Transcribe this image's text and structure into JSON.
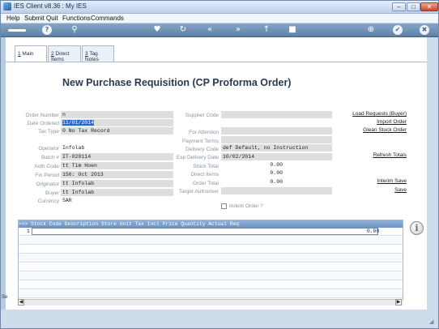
{
  "window": {
    "title": "IES Client v8.36 : My IES",
    "min": "–",
    "max": "□",
    "close": "✕"
  },
  "menu": [
    "Help",
    "Submit",
    "Quit",
    "Functions",
    "Commands"
  ],
  "toolbar": {
    "help": "?",
    "search": "⚲",
    "fav": "♥",
    "refresh": "↻",
    "back": "«",
    "forward": "»",
    "info": "↑",
    "stop": "■",
    "globe": "⊕",
    "ok": "✔",
    "close": "✖"
  },
  "tabs": [
    {
      "prefix": "1",
      "label": " Main"
    },
    {
      "prefix": "2",
      "label": " Direct Items"
    },
    {
      "prefix": "3",
      "label": " Tag Notes"
    }
  ],
  "page_title": "New Purchase  Requisition  (CP Proforma Order)",
  "left_fields": [
    {
      "label": "Order Number",
      "value": "n"
    },
    {
      "label": "Date Ordered",
      "value": "11/01/2014"
    },
    {
      "label": "Tax Type",
      "value": "0 No Tax Record"
    },
    {
      "label": "Operator",
      "value": "Infolab"
    },
    {
      "label": "Batch #",
      "value": "IT-020114"
    },
    {
      "label": "Auth Code",
      "value": "tt Tim Hoen"
    },
    {
      "label": "Fin Period",
      "value": "156: Oct 2013"
    },
    {
      "label": "Originator",
      "value": "tt Infolab"
    },
    {
      "label": "Buyer",
      "value": "tt Infolab"
    },
    {
      "label": "Currency",
      "value": "SAR"
    }
  ],
  "right_fields": [
    {
      "label": "Supplier Code",
      "value": ""
    },
    {
      "label": "For Attention",
      "value": ""
    },
    {
      "label": "Payment Terms",
      "value": ""
    },
    {
      "label": "Delivery Code",
      "value": "def Default, no Instruction"
    },
    {
      "label": "Exp Delivery Date",
      "value": "10/02/2014"
    },
    {
      "label": "Stock Total",
      "value": "0.00"
    },
    {
      "label": "Direct Items",
      "value": "0.00"
    },
    {
      "label": "Order Total",
      "value": "0.00"
    },
    {
      "label": "Target Authoriser",
      "value": ""
    }
  ],
  "indent_label": "Indent Order ?",
  "links": {
    "load": "Load Requests (Buyer)",
    "import": "Import Order",
    "glean": "Glean Stock Order",
    "refresh": "Refresh Totals",
    "interim": "Interim Save",
    "save": "Save"
  },
  "grid": {
    "header": ">>> Stock Code Description           Store Unit  Tax Incl Price        Quantity   Actual                  Req",
    "rows": [
      {
        "num": "1",
        "value": "0.00"
      }
    ]
  },
  "info_icon": "i",
  "status": "Se"
}
